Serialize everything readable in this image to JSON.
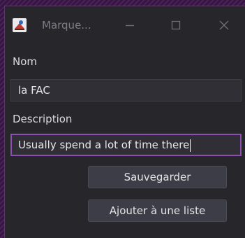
{
  "window": {
    "title": "Marque..."
  },
  "form": {
    "name_label": "Nom",
    "name_value": "la FAC",
    "description_label": "Description",
    "description_value": "Usually spend a lot of time there"
  },
  "buttons": {
    "save_label": "Sauvegarder",
    "add_to_list_label": "Ajouter à une liste"
  },
  "colors": {
    "window_bg": "#26262b",
    "focus_border": "#8c4fb2",
    "desktop_bg": "#3a1a44"
  },
  "icons": {
    "app": "java-app-icon",
    "minimize": "minimize-icon",
    "maximize": "maximize-icon",
    "close": "close-icon"
  }
}
